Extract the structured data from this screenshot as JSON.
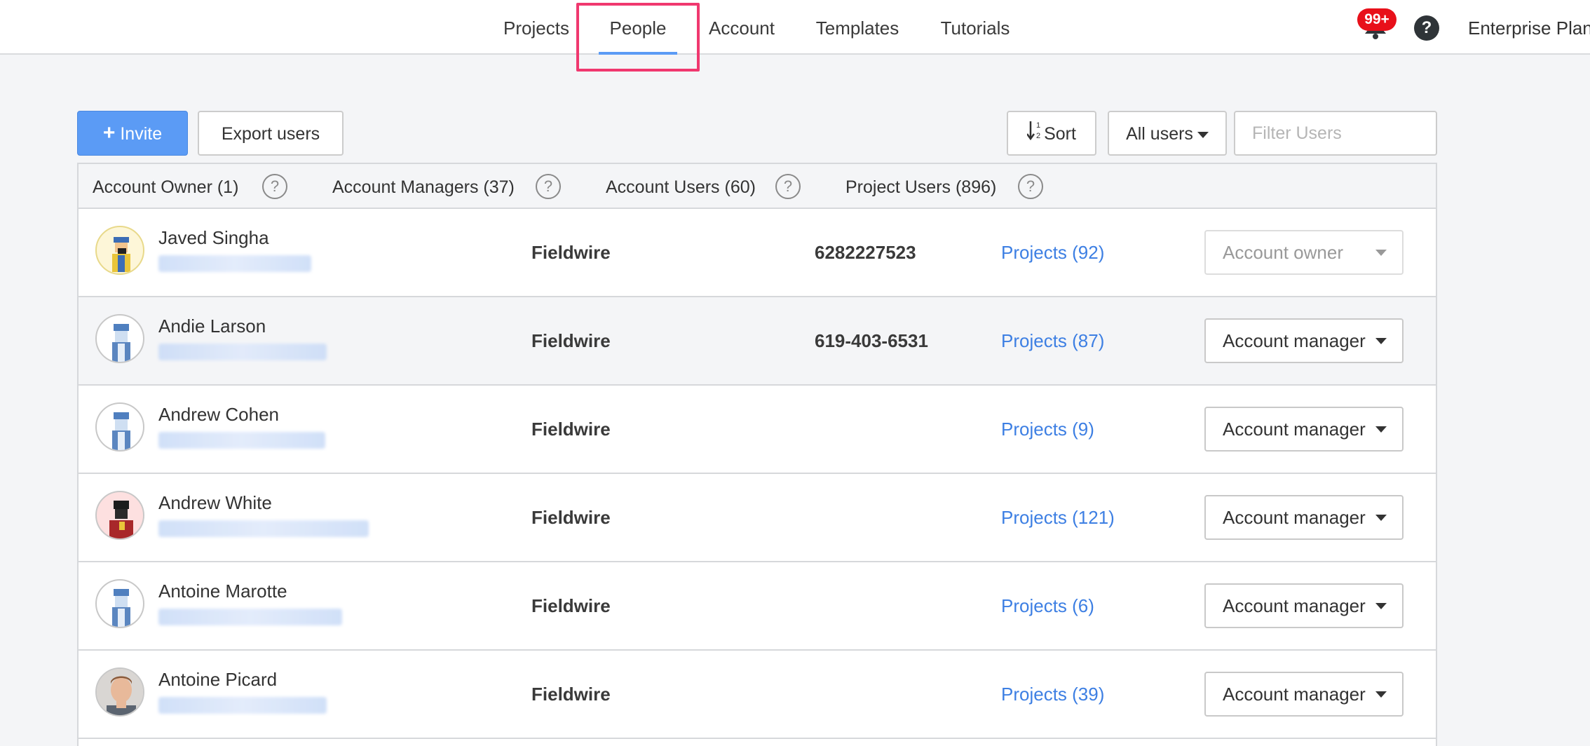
{
  "nav": {
    "items": [
      {
        "label": "Projects",
        "active": false
      },
      {
        "label": "People",
        "active": true
      },
      {
        "label": "Account",
        "active": false
      },
      {
        "label": "Templates",
        "active": false
      },
      {
        "label": "Tutorials",
        "active": false
      }
    ],
    "notification_badge": "99+",
    "help_glyph": "?",
    "plan_label": "Enterprise Plan"
  },
  "toolbar": {
    "invite_label": "Invite",
    "export_label": "Export users",
    "sort_label": "Sort",
    "filter_dropdown_label": "All users",
    "filter_placeholder": "Filter Users",
    "accent_color": "#5b9bf5"
  },
  "tabs": [
    {
      "label": "Account Owner (1)"
    },
    {
      "label": "Account Managers (37)"
    },
    {
      "label": "Account Users (60)"
    },
    {
      "label": "Project Users (896)"
    }
  ],
  "users": [
    {
      "name": "Javed Singha",
      "company": "Fieldwire",
      "phone": "6282227523",
      "projects": "Projects (92)",
      "role": "Account owner",
      "avatar": "worker-yellow"
    },
    {
      "name": "Andie Larson",
      "company": "Fieldwire",
      "phone": "619-403-6531",
      "projects": "Projects (87)",
      "role": "Account manager",
      "avatar": "worker-blue"
    },
    {
      "name": "Andrew Cohen",
      "company": "Fieldwire",
      "phone": "",
      "projects": "Projects (9)",
      "role": "Account manager",
      "avatar": "worker-blue"
    },
    {
      "name": "Andrew White",
      "company": "Fieldwire",
      "phone": "",
      "projects": "Projects (121)",
      "role": "Account manager",
      "avatar": "worker-red"
    },
    {
      "name": "Antoine Marotte",
      "company": "Fieldwire",
      "phone": "",
      "projects": "Projects (6)",
      "role": "Account manager",
      "avatar": "worker-blue"
    },
    {
      "name": "Antoine Picard",
      "company": "Fieldwire",
      "phone": "",
      "projects": "Projects (39)",
      "role": "Account manager",
      "avatar": "photo"
    }
  ]
}
